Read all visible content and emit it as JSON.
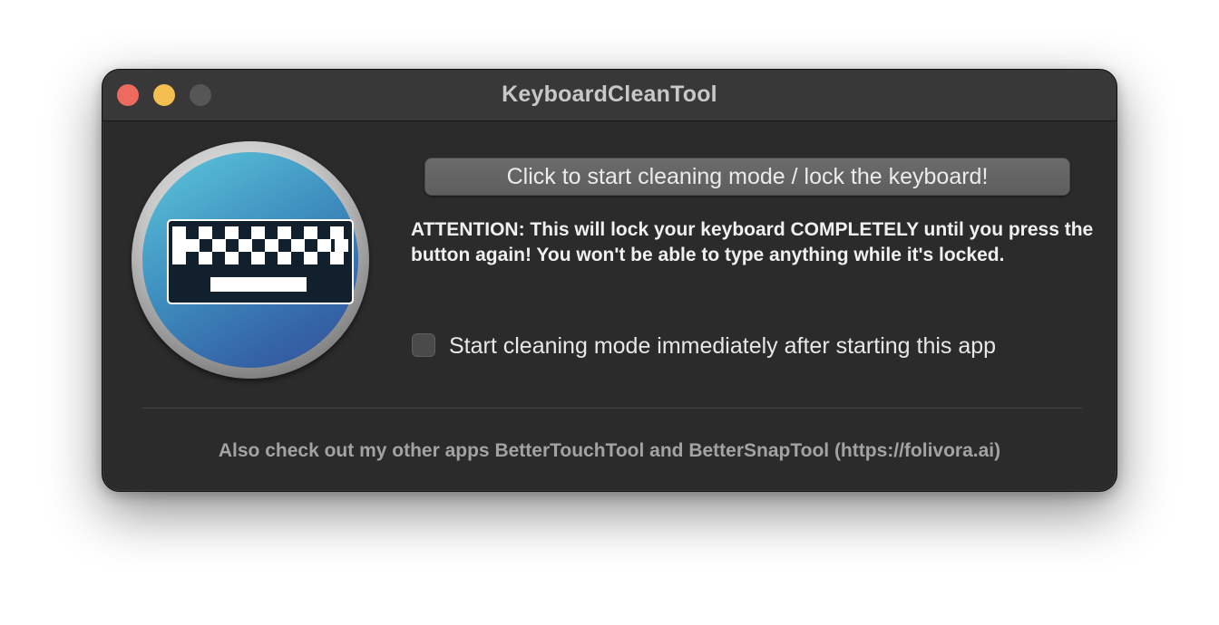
{
  "window": {
    "title": "KeyboardCleanTool"
  },
  "traffic_lights": {
    "close_color": "#ed6a5e",
    "minimize_color": "#f5bf4f",
    "zoom_color": "#565656"
  },
  "app_icon": {
    "icon": "keyboard-icon"
  },
  "main": {
    "lock_button_label": "Click to start cleaning mode / lock the keyboard!",
    "attention_text": "ATTENTION: This will lock your keyboard COMPLETELY until you press the button again! You won't be able to type anything while it's locked.",
    "autostart_checkbox": {
      "label": "Start cleaning mode immediately after starting this app",
      "checked": false
    }
  },
  "footer": {
    "text": "Also check out my other apps BetterTouchTool and BetterSnapTool (https://folivora.ai)"
  }
}
